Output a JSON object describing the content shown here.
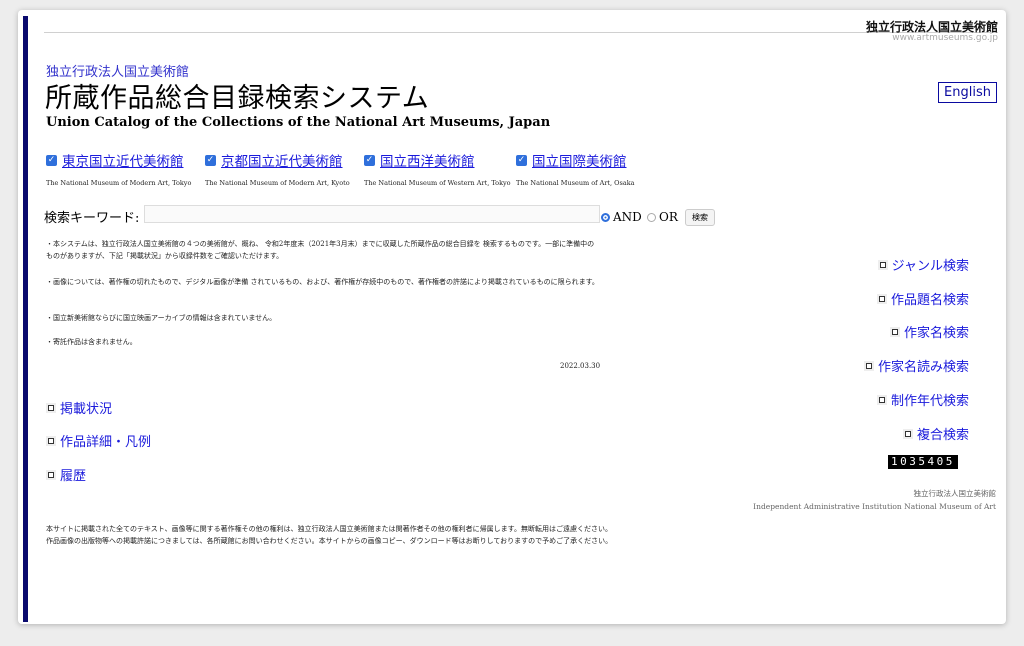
{
  "header": {
    "brand_jp": "独立行政法人国立美術館",
    "brand_url": "www.artmuseums.go.jp",
    "subhead": "独立行政法人国立美術館",
    "title": "所蔵作品総合目録検索システム",
    "subtitle_en": "Union Catalog of the Collections of the National Art Museums, Japan",
    "english_button": "English"
  },
  "museums": [
    {
      "name": "東京国立近代美術館",
      "en": "The National Museum of Modern Art, Tokyo",
      "checked": true
    },
    {
      "name": "京都国立近代美術館",
      "en": "The National Museum of Modern Art, Kyoto",
      "checked": true
    },
    {
      "name": "国立西洋美術館",
      "en": "The National Museum of Western Art, Tokyo",
      "checked": true
    },
    {
      "name": "国立国際美術館",
      "en": "The National Museum of Art, Osaka",
      "checked": true
    }
  ],
  "search": {
    "label": "検索キーワード:",
    "value": "",
    "and_label": "AND",
    "or_label": "OR",
    "selected": "AND",
    "button": "検索"
  },
  "notices": [
    "・本システムは、独立行政法人国立美術館の４つの美術館が、概ね、 令和2年度末（2021年3月末）までに収蔵した所蔵作品の総合目録を 検索するものです。一部に準備中のものがありますが、下記「掲載状況」から収録件数をご確認いただけます。",
    "・画像については、著作権の切れたもので、デジタル画像が準備 されているもの、および、著作権が存続中のもので、著作権者の許諾により掲載されているものに限られます。",
    "・国立新美術館ならびに国立映画アーカイブの情報は含まれていません。",
    "・寄託作品は含まれません。"
  ],
  "date": "2022.03.30",
  "left_links": [
    "掲載状況",
    "作品詳細・凡例",
    "履歴"
  ],
  "right_links": [
    "ジャンル検索",
    "作品題名検索",
    "作家名検索",
    "作家名読み検索",
    "制作年代検索",
    "複合検索"
  ],
  "counter": "1035405",
  "footer": {
    "org_jp": "独立行政法人国立美術館",
    "org_en": "Independent Administrative Institution National Museum of Art",
    "copyright_1": "本サイトに掲載された全てのテキスト、画像等に関する著作権その他の権利は、独立行政法人国立美術館または関著作者その他の権利者に帰属します。無断転用はご遠慮ください。",
    "copyright_2": "作品画像の出版物等への掲載許諾につきましては、各所蔵館にお問い合わせください。本サイトからの画像コピー、ダウンロード等はお断りしておりますので予めご了承ください。"
  }
}
